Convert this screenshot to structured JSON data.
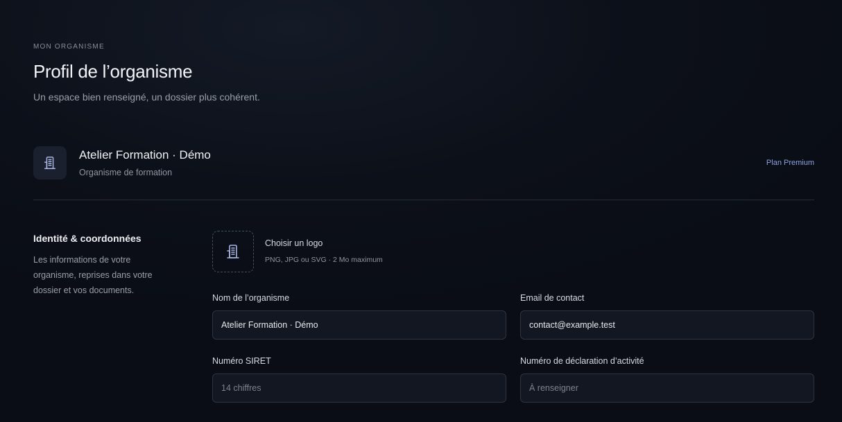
{
  "header": {
    "eyebrow": "MON ORGANISME",
    "title": "Profil de l’organisme",
    "subtitle": "Un espace bien renseigné, un dossier plus cohérent."
  },
  "organization": {
    "icon": "building-icon",
    "name": "Atelier Formation · Démo",
    "type": "Organisme de formation",
    "plan_label": "Plan Premium"
  },
  "section": {
    "title": "Identité & coordonnées",
    "description": "Les informations de votre organisme, reprises dans votre dossier et vos documents."
  },
  "logo": {
    "icon": "building-icon",
    "choose_label": "Choisir un logo",
    "hint": "PNG, JPG ou SVG · 2 Mo maximum"
  },
  "form": {
    "name": {
      "label": "Nom de l’organisme",
      "value": "Atelier Formation · Démo",
      "placeholder": ""
    },
    "email": {
      "label": "Email de contact",
      "value": "contact@example.test",
      "placeholder": ""
    },
    "siret": {
      "label": "Numéro SIRET",
      "value": "",
      "placeholder": "14 chiffres"
    },
    "declaration": {
      "label": "Numéro de déclaration d’activité",
      "value": "",
      "placeholder": "À renseigner"
    }
  },
  "colors": {
    "background": "#0c1019",
    "accent": "#8ea2e0",
    "input_bg": "#121722",
    "border": "#2d3441"
  }
}
